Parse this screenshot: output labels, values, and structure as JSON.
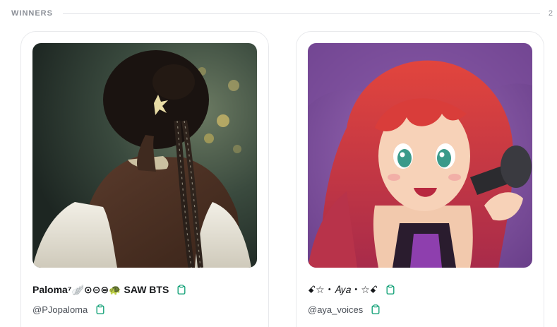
{
  "section": {
    "title": "WINNERS",
    "count": "2"
  },
  "winners": [
    {
      "display_name": "Paloma⁷🪽⊙⊝⊜🐢 SAW BTS",
      "handle": "@PJopaloma",
      "avatar_icon": "woman-back-photo"
    },
    {
      "display_name": "ꗃ☆・𝐴𝑦𝑎・☆ꗃ",
      "handle": "@aya_voices",
      "avatar_icon": "anime-girl-microphone"
    }
  ],
  "colors": {
    "accent": "#17a37a",
    "muted": "#8b8f97"
  }
}
